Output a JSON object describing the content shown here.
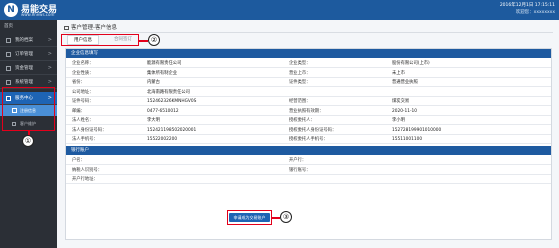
{
  "header": {
    "logo_mark": "N",
    "logo_title": "易能交易",
    "logo_subtitle": "www.enews.com",
    "datetime": "2016年12月1日 17:15:11",
    "user": "欢迎您：xxxxxxxx"
  },
  "sidebar": {
    "home": "首页",
    "items": [
      {
        "label": "我的档案"
      },
      {
        "label": "订单管理"
      },
      {
        "label": "资金管理"
      },
      {
        "label": "系统管理"
      },
      {
        "label": "服务中心"
      }
    ],
    "active_sub": "注册信息",
    "sub2": "客户维护",
    "chevron": ">"
  },
  "annotations": {
    "one": "①",
    "two": "②",
    "three": "③"
  },
  "main": {
    "breadcrumb": "客户管理-客户信息",
    "tabs": [
      {
        "label": "用户信息"
      },
      {
        "label": "合同签订"
      }
    ]
  },
  "panel": {
    "section1_title": "企业信息填写",
    "rows": [
      [
        "企业名称：",
        "能源有限责任公司",
        "企业类型：",
        "股份有限公司(上市)"
      ],
      [
        "企业性质：",
        "集体所有制企业",
        "营业上市：",
        "未上市"
      ],
      [
        "省份：",
        "内蒙古",
        "证件类型：",
        "普通营业执照"
      ],
      [
        "公司地址：",
        "北海南路有限责任公司",
        "",
        ""
      ],
      [
        "证件号码：",
        "152462326KMNHGV0S",
        "经营范围：",
        "煤炭交易"
      ],
      [
        "邮编：",
        "0477-6510012",
        "营业执照有效期：",
        "2020-11-10"
      ],
      [
        "法人姓名：",
        "李大明",
        "授权委托人：",
        "李小明"
      ],
      [
        "法人身份证号码：",
        "152421198502020001",
        "授权委托人身份证号码：",
        "152728199901010000"
      ],
      [
        "法人手机号：",
        "15522002200",
        "授权委托人手机号：",
        "15511001100"
      ]
    ],
    "section2_title": "银行账户",
    "bank_rows": [
      [
        "户名：",
        "",
        "开户行：",
        ""
      ],
      [
        "纳税人识别号：",
        "",
        "银行账号：",
        ""
      ],
      [
        "开户行地址：",
        "",
        "",
        ""
      ]
    ],
    "next_button": "申请成为交易账户"
  }
}
